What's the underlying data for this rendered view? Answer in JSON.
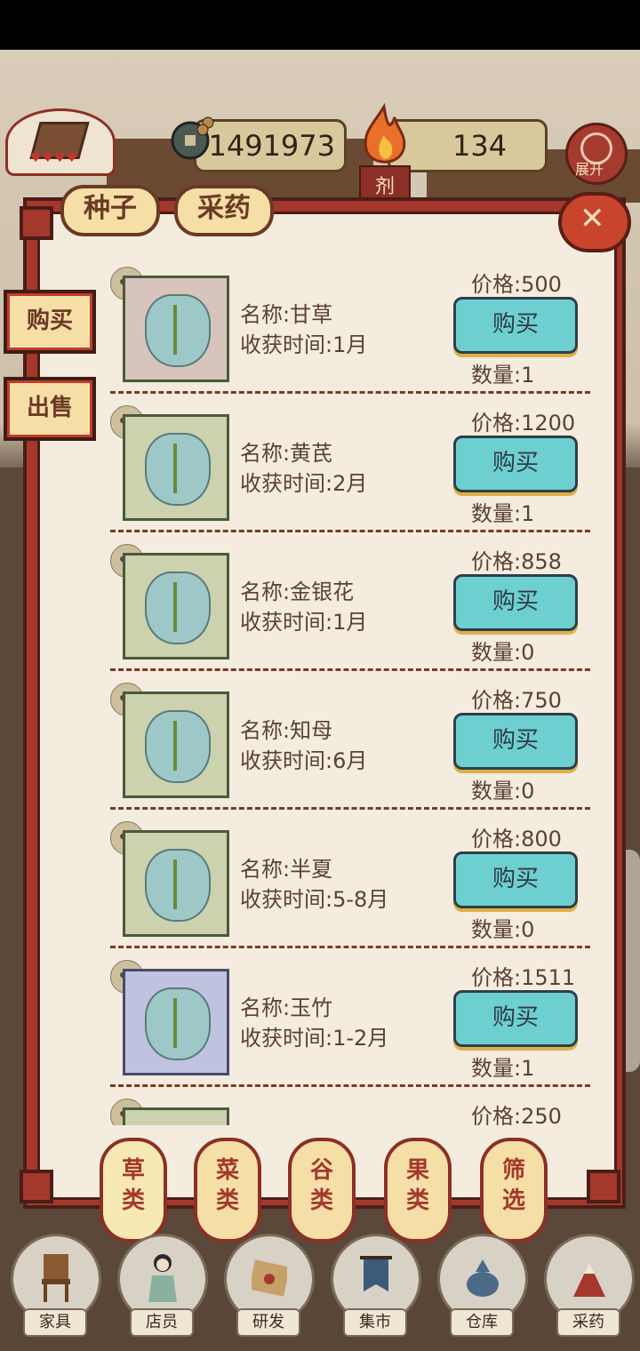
{
  "hud": {
    "money": "1491973",
    "fire": "134",
    "dose_tag": "剂",
    "expand_label": "展开"
  },
  "tabs": {
    "seed": "种子",
    "herb": "采药"
  },
  "side": {
    "buy": "购买",
    "sell": "出售"
  },
  "items": [
    {
      "name": "名称:甘草",
      "harvest": "收获时间:1月",
      "price": "价格:500",
      "buy": "购买",
      "qty": "数量:1",
      "bg": "#d7c4bc"
    },
    {
      "name": "名称:黄芪",
      "harvest": "收获时间:2月",
      "price": "价格:1200",
      "buy": "购买",
      "qty": "数量:1",
      "bg": "#cbd2ad"
    },
    {
      "name": "名称:金银花",
      "harvest": "收获时间:1月",
      "price": "价格:858",
      "buy": "购买",
      "qty": "数量:0",
      "bg": "#cbd2ad"
    },
    {
      "name": "名称:知母",
      "harvest": "收获时间:6月",
      "price": "价格:750",
      "buy": "购买",
      "qty": "数量:0",
      "bg": "#cbd2ad"
    },
    {
      "name": "名称:半夏",
      "harvest": "收获时间:5-8月",
      "price": "价格:800",
      "buy": "购买",
      "qty": "数量:0",
      "bg": "#cbd2ad"
    },
    {
      "name": "名称:玉竹",
      "harvest": "收获时间:1-2月",
      "price": "价格:1511",
      "buy": "购买",
      "qty": "数量:1",
      "bg": "#bfc3e0"
    },
    {
      "price": "价格:250",
      "bg": "#cbd2ad"
    }
  ],
  "categories": [
    "草类",
    "菜类",
    "谷类",
    "果类",
    "筛选"
  ],
  "nav": [
    "家具",
    "店员",
    "研发",
    "集市",
    "仓库",
    "采药"
  ],
  "colors": {
    "panel_red": "#a4382c",
    "buy_cyan": "#6ecfd0",
    "tab_cream": "#f5dfa6"
  }
}
